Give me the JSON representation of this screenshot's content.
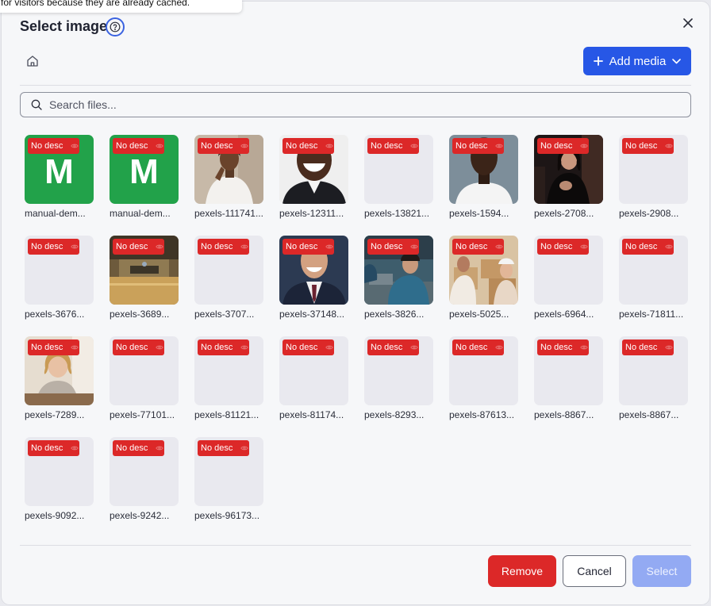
{
  "tooltip": {
    "text": "for visitors because they are already cached."
  },
  "dialog": {
    "title": "Select image",
    "help_icon": "help-circle-icon",
    "close_icon": "close-icon"
  },
  "toolbar": {
    "home_icon": "home-icon",
    "add_media_label": "Add media",
    "add_media_icon": "plus-icon",
    "add_media_chevron": "chevron-down-icon"
  },
  "search": {
    "placeholder": "Search files...",
    "value": "",
    "icon": "search-icon"
  },
  "colors": {
    "primary": "#2757e6",
    "danger": "#dc2828",
    "brand_green": "#22a24a",
    "disabled_primary": "#93aaf3"
  },
  "files": [
    {
      "name": "manual-dem...",
      "badge": "No desc",
      "thumb": "manual-logo",
      "letter": "M"
    },
    {
      "name": "manual-dem...",
      "badge": "No desc",
      "thumb": "manual-logo",
      "letter": "M"
    },
    {
      "name": "pexels-111741...",
      "badge": "No desc",
      "thumb": "photo-woman-white"
    },
    {
      "name": "pexels-12311...",
      "badge": "No desc",
      "thumb": "photo-man-smile"
    },
    {
      "name": "pexels-13821...",
      "badge": "No desc",
      "thumb": "blank"
    },
    {
      "name": "pexels-1594...",
      "badge": "No desc",
      "thumb": "photo-man-tshirt"
    },
    {
      "name": "pexels-2708...",
      "badge": "No desc",
      "thumb": "photo-woman-dark"
    },
    {
      "name": "pexels-2908...",
      "badge": "No desc",
      "thumb": "blank"
    },
    {
      "name": "pexels-3676...",
      "badge": "No desc",
      "thumb": "blank"
    },
    {
      "name": "pexels-3689...",
      "badge": "No desc",
      "thumb": "photo-lobby"
    },
    {
      "name": "pexels-3707...",
      "badge": "No desc",
      "thumb": "blank"
    },
    {
      "name": "pexels-37148...",
      "badge": "No desc",
      "thumb": "photo-man-suit"
    },
    {
      "name": "pexels-3826...",
      "badge": "No desc",
      "thumb": "photo-workshop"
    },
    {
      "name": "pexels-5025...",
      "badge": "No desc",
      "thumb": "photo-boxes"
    },
    {
      "name": "pexels-6964...",
      "badge": "No desc",
      "thumb": "blank"
    },
    {
      "name": "pexels-71811...",
      "badge": "No desc",
      "thumb": "blank"
    },
    {
      "name": "pexels-7289...",
      "badge": "No desc",
      "thumb": "photo-woman-desk"
    },
    {
      "name": "pexels-77101...",
      "badge": "No desc",
      "thumb": "blank"
    },
    {
      "name": "pexels-81121...",
      "badge": "No desc",
      "thumb": "blank"
    },
    {
      "name": "pexels-81174...",
      "badge": "No desc",
      "thumb": "blank"
    },
    {
      "name": "pexels-8293...",
      "badge": "No desc",
      "thumb": "blank"
    },
    {
      "name": "pexels-87613...",
      "badge": "No desc",
      "thumb": "blank"
    },
    {
      "name": "pexels-8867...",
      "badge": "No desc",
      "thumb": "blank"
    },
    {
      "name": "pexels-8867...",
      "badge": "No desc",
      "thumb": "blank"
    },
    {
      "name": "pexels-9092...",
      "badge": "No desc",
      "thumb": "blank"
    },
    {
      "name": "pexels-9242...",
      "badge": "No desc",
      "thumb": "blank"
    },
    {
      "name": "pexels-96173...",
      "badge": "No desc",
      "thumb": "blank"
    }
  ],
  "footer": {
    "remove_label": "Remove",
    "cancel_label": "Cancel",
    "select_label": "Select"
  }
}
